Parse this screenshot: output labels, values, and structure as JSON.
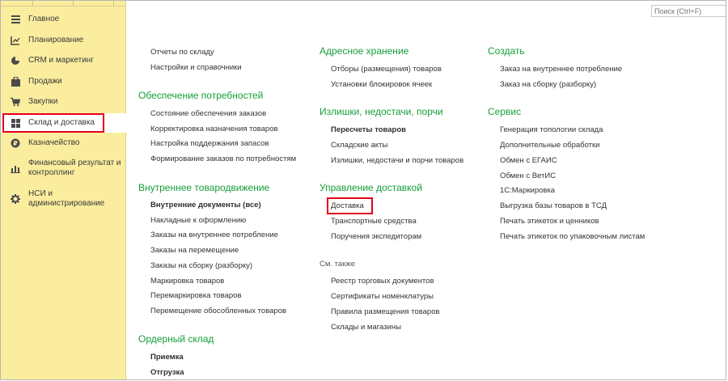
{
  "search": {
    "placeholder": "Поиск (Ctrl+F)"
  },
  "sidebar": {
    "items": [
      {
        "label": "Главное",
        "icon": "menu-icon"
      },
      {
        "label": "Планирование",
        "icon": "planning-icon"
      },
      {
        "label": "CRM и маркетинг",
        "icon": "pie-chart-icon"
      },
      {
        "label": "Продажи",
        "icon": "bag-icon"
      },
      {
        "label": "Закупки",
        "icon": "cart-icon"
      },
      {
        "label": "Склад и доставка",
        "icon": "warehouse-grid-icon"
      },
      {
        "label": "Казначейство",
        "icon": "coin-icon"
      },
      {
        "label": "Финансовый результат и контроллинг",
        "icon": "bar-chart-icon"
      },
      {
        "label": "НСИ и администрирование",
        "icon": "gear-icon"
      }
    ],
    "active_index": 5
  },
  "col1": {
    "top_links": [
      "Отчеты по складу",
      "Настройки и справочники"
    ],
    "sections": [
      {
        "title": "Обеспечение потребностей",
        "links": [
          "Состояние обеспечения заказов",
          "Корректировка назначения товаров",
          "Настройка поддержания запасов",
          "Формирование заказов по потребностям"
        ]
      },
      {
        "title": "Внутреннее товародвижение",
        "links": [
          "Внутренние документы (все)",
          "Накладные к оформлению",
          "Заказы на внутреннее потребление",
          "Заказы на перемещение",
          "Заказы на сборку (разборку)",
          "Маркировка товаров",
          "Перемаркировка товаров",
          "Перемещение обособленных товаров"
        ]
      },
      {
        "title": "Ордерный склад",
        "links": [
          "Приемка",
          "Отгрузка"
        ]
      }
    ]
  },
  "col2": {
    "sections": [
      {
        "title": "Адресное хранение",
        "links": [
          "Отборы (размещения) товаров",
          "Установки блокировок ячеек"
        ]
      },
      {
        "title": "Излишки, недостачи, порчи",
        "links": [
          "Пересчеты товаров",
          "Складские акты",
          "Излишки, недостачи и порчи товаров"
        ]
      },
      {
        "title": "Управление доставкой",
        "links": [
          "Доставка",
          "Транспортные средства",
          "Поручения экспедиторам"
        ]
      }
    ],
    "see_also": {
      "title": "См. также",
      "links": [
        "Реестр торговых документов",
        "Сертификаты номенклатуры",
        "Правила размещения товаров",
        "Склады и магазины"
      ]
    }
  },
  "col3": {
    "sections": [
      {
        "title": "Создать",
        "links": [
          "Заказ на внутреннее потребление",
          "Заказ на сборку (разборку)"
        ]
      },
      {
        "title": "Сервис",
        "links": [
          "Генерация топологии склада",
          "Дополнительные обработки",
          "Обмен с ЕГАИС",
          "Обмен с ВетИС",
          "1С:Маркировка",
          "Выгрузка базы товаров в ТСД",
          "Печать этикеток и ценников",
          "Печать этикеток по упаковочным листам"
        ]
      }
    ]
  }
}
